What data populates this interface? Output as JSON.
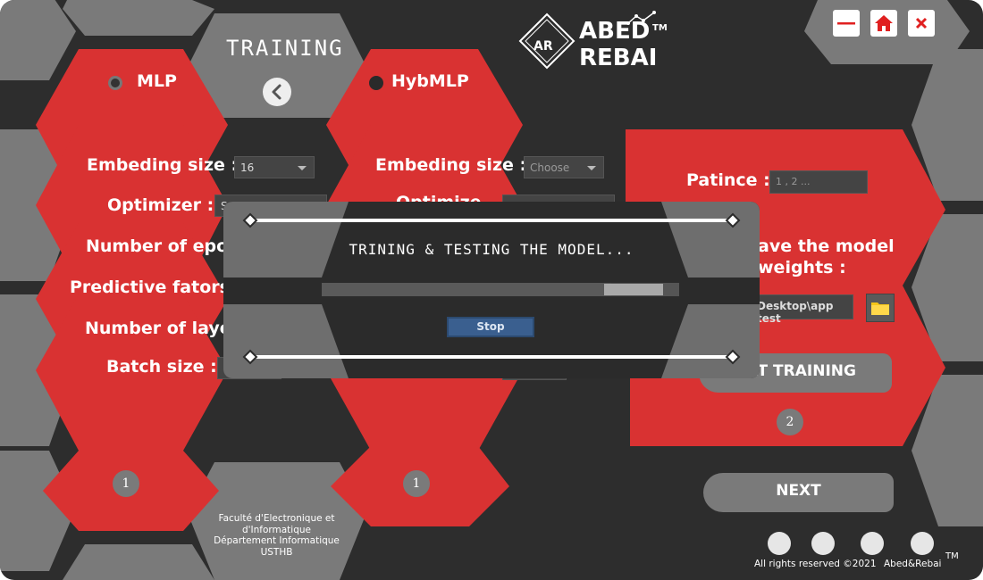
{
  "header": {
    "page_title": "TRAINING",
    "logo_mark": "AR",
    "logo_line1": "ABED",
    "logo_line2": "REBAI",
    "trademark": "TM"
  },
  "window_controls": {
    "minimize": "minimize-icon",
    "home": "home-icon",
    "close": "close-icon"
  },
  "mlp": {
    "option_label": "MLP",
    "selected": true,
    "embeding_label": "Embeding size :",
    "embeding_value": "16",
    "optimizer_label": "Optimizer :",
    "optimizer_value": "S",
    "epochs_label": "Number of epoc",
    "factors_label": "Predictive fators:",
    "layers_label": "Number of laye",
    "batch_label": "Batch size :",
    "step": "1"
  },
  "hybmlp": {
    "option_label": "HybMLP",
    "selected": false,
    "embeding_label": "Embeding size :",
    "embeding_placeholder": "Choose",
    "optimizer_label": "Optimize",
    "step": "1"
  },
  "settings": {
    "patience_label": "Patince :",
    "patience_placeholder": "1 , 2 ...",
    "save_label_line1": "ave the model",
    "save_label_line2": "weights :",
    "path_value": "Desktop\\app test",
    "start_button": "ART TRAINING",
    "step": "2"
  },
  "next_button": "NEXT",
  "institution": [
    "Faculté d'Electronique et",
    "d'Informatique",
    "Département Informatique",
    "USTHB"
  ],
  "modal": {
    "message": "TRINING & TESTING THE MODEL...",
    "progress": 0.81,
    "stop_label": "Stop"
  },
  "footer": {
    "rights": "All rights reserved ©2021",
    "author": "Abed&Rebai",
    "trademark": "TM"
  },
  "colors": {
    "red": "#d93232",
    "gray": "#7a7a7a",
    "dark": "#2d2d2d",
    "accent_blue": "#3a5f8f"
  }
}
